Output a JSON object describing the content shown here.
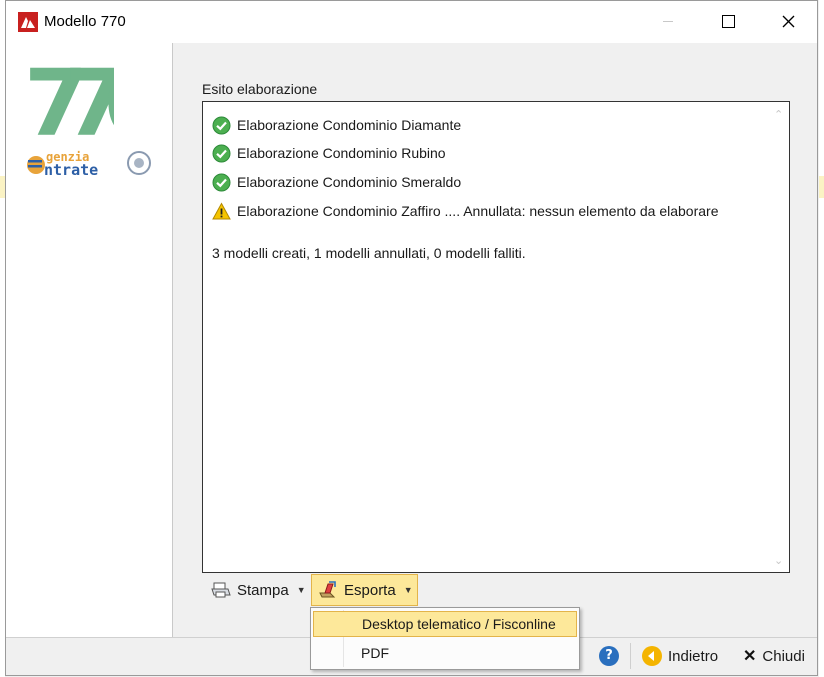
{
  "window": {
    "title": "Modello 770",
    "icons": {
      "app": "modello-770-icon",
      "minimize": "minimize-icon",
      "maximize": "maximize-icon",
      "close": "close-icon"
    }
  },
  "sidebar": {
    "logo_number": "770",
    "agency_line1": "genzia",
    "agency_line2": "ntrate"
  },
  "main": {
    "section_label": "Esito elaborazione",
    "results": [
      {
        "status": "success",
        "icon": "check-circle-icon",
        "text": "Elaborazione Condominio Diamante"
      },
      {
        "status": "success",
        "icon": "check-circle-icon",
        "text": "Elaborazione Condominio Rubino"
      },
      {
        "status": "success",
        "icon": "check-circle-icon",
        "text": "Elaborazione Condominio Smeraldo"
      },
      {
        "status": "warning",
        "icon": "warning-icon",
        "text": "Elaborazione Condominio Zaffiro .... Annullata: nessun elemento da elaborare"
      }
    ],
    "summary": "3 modelli creati, 1 modelli annullati, 0 modelli falliti."
  },
  "toolbar": {
    "print_label": "Stampa",
    "export_label": "Esporta"
  },
  "export_menu": {
    "items": [
      "Desktop telematico / Fisconline",
      "PDF"
    ],
    "highlighted_index": 0
  },
  "footer": {
    "help_label": "?",
    "back_label": "Indietro",
    "close_label": "Chiudi"
  },
  "colors": {
    "accent_highlight": "#fde89a",
    "accent_border": "#e3b44a",
    "success": "#4caf50",
    "warning": "#f5c400",
    "app_red": "#c8201f"
  }
}
